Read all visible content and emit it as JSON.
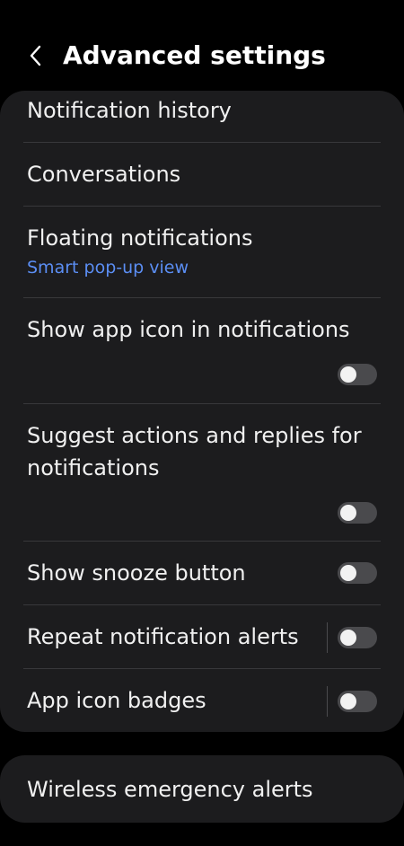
{
  "header": {
    "title": "Advanced settings",
    "back_icon": "chevron-left-icon"
  },
  "settings": {
    "notification_history": {
      "label": "Notification history"
    },
    "conversations": {
      "label": "Conversations"
    },
    "floating_notifications": {
      "label": "Floating notifications",
      "sublabel": "Smart pop-up view",
      "sublabel_color": "#5b8ef4"
    },
    "show_app_icon": {
      "label": "Show app icon in notifications",
      "enabled": false
    },
    "suggest_actions": {
      "label": "Suggest actions and replies for notifications",
      "enabled": false
    },
    "show_snooze": {
      "label": "Show snooze button",
      "enabled": false
    },
    "repeat_alerts": {
      "label": "Repeat notification alerts",
      "enabled": false
    },
    "app_icon_badges": {
      "label": "App icon badges",
      "enabled": false
    }
  },
  "wireless": {
    "label": "Wireless emergency alerts"
  },
  "colors": {
    "background": "#000000",
    "card": "#1c1c1e",
    "accent": "#5b8ef4",
    "toggle_off_track": "#4a4a4d",
    "toggle_knob": "#f2f2f2"
  }
}
